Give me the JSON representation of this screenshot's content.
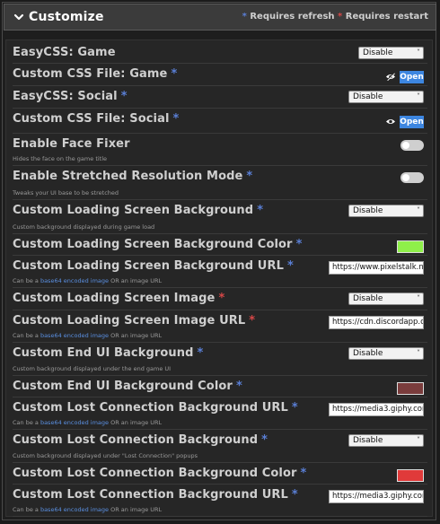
{
  "header": {
    "title": "Customize",
    "legend_refresh_mark": "*",
    "legend_refresh_text": "Requires refresh",
    "legend_restart_mark": "*",
    "legend_restart_text": "Requires restart"
  },
  "colors": {
    "refresh": "#5a7fd6",
    "restart": "#d64747",
    "link": "#5a8fe0",
    "button": "#3d86e0"
  },
  "settings": [
    {
      "label": "EasyCSS: Game",
      "mark": "",
      "control": "select",
      "value": "Disable"
    },
    {
      "label": "Custom CSS File: Game",
      "mark": "*",
      "control": "open",
      "value": "Open",
      "icon": "eye-slash-icon"
    },
    {
      "label": "EasyCSS: Social",
      "mark": "*",
      "control": "select",
      "value": "Disable"
    },
    {
      "label": "Custom CSS File: Social",
      "mark": "*",
      "control": "open",
      "value": "Open",
      "icon": "eye-icon"
    },
    {
      "label": "Enable Face Fixer",
      "mark": "",
      "control": "toggle",
      "desc": "Hides the face on the game title"
    },
    {
      "label": "Enable Stretched Resolution Mode",
      "mark": "*",
      "control": "toggle",
      "desc": "Tweaks your UI base to be stretched"
    },
    {
      "label": "Custom Loading Screen Background",
      "mark": "*",
      "control": "select",
      "value": "Disable",
      "desc": "Custom background displayed during game load"
    },
    {
      "label": "Custom Loading Screen Background Color",
      "mark": "*",
      "control": "color",
      "color": "#8ff04a"
    },
    {
      "label": "Custom Loading Screen Background URL",
      "mark": "*",
      "control": "text",
      "value": "https://www.pixelstalk.n",
      "desc_pre": "Can be a ",
      "desc_link": "base64 encoded image",
      "desc_post": " OR an image URL"
    },
    {
      "label": "Custom Loading Screen Image",
      "mark": "*",
      "markColor": "r",
      "control": "select",
      "value": "Disable"
    },
    {
      "label": "Custom Loading Screen Image URL",
      "mark": "*",
      "markColor": "r",
      "control": "text",
      "value": "https://cdn.discordapp.cc",
      "desc_pre": "Can be a ",
      "desc_link": "base64 encoded image",
      "desc_post": " OR an image URL"
    },
    {
      "label": "Custom End UI Background",
      "mark": "*",
      "control": "select",
      "value": "Disable",
      "desc": "Custom background displayed under the end game UI"
    },
    {
      "label": "Custom End UI Background Color",
      "mark": "*",
      "control": "color",
      "color": "#7a3c3c"
    },
    {
      "label": "Custom Lost Connection Background URL",
      "mark": "*",
      "control": "text",
      "value": "https://media3.giphy.com",
      "desc_pre": "Can be a ",
      "desc_link": "base64 encoded image",
      "desc_post": " OR an image URL"
    },
    {
      "label": "Custom Lost Connection Background",
      "mark": "*",
      "control": "select",
      "value": "Disable",
      "desc": "Custom background displayed under \"Lost Connection\" popups"
    },
    {
      "label": "Custom Lost Connection Background Color",
      "mark": "*",
      "control": "color",
      "color": "#e03a3a"
    },
    {
      "label": "Custom Lost Connection Background URL",
      "mark": "*",
      "control": "text",
      "value": "https://media3.giphy.com",
      "desc_pre": "Can be a ",
      "desc_link": "base64 encoded image",
      "desc_post": " OR an image URL"
    }
  ]
}
